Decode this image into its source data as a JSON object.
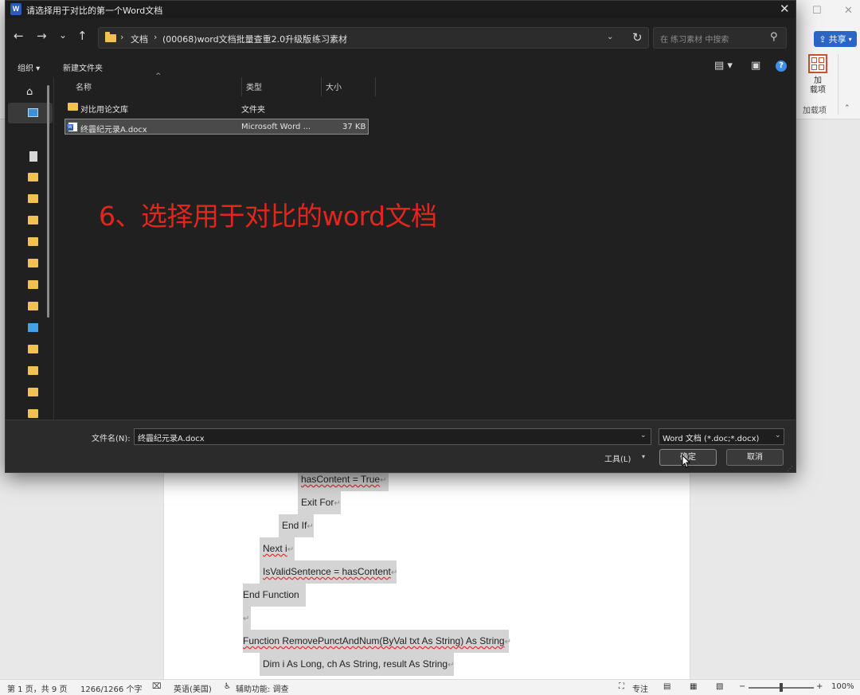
{
  "dialog": {
    "title": "请选择用于对比的第一个Word文档",
    "close_icon": "✕",
    "nav": {
      "back": "←",
      "forward": "→",
      "recent": "⌄",
      "up": "↑",
      "breadcrumbs": [
        "文档",
        "(00068)word文档批量查重2.0升级版",
        "练习素材"
      ],
      "separator": "›",
      "search_placeholder": "在 练习素材 中搜索"
    },
    "toolbar": {
      "organize": "组织",
      "new_folder": "新建文件夹"
    },
    "columns": {
      "name": "名称",
      "type": "类型",
      "size": "大小"
    },
    "files": [
      {
        "name": "对比用论文库",
        "type": "文件夹",
        "size": ""
      },
      {
        "name": "终霾纪元录A.docx",
        "type": "Microsoft Word ...",
        "size": "37 KB"
      }
    ],
    "annotation": "6、选择用于对比的word文档",
    "filename_label": "文件名(N):",
    "filename_value": "终霾纪元录A.docx",
    "filetype": "Word 文档 (*.doc;*.docx)",
    "tools": "工具(L)",
    "ok": "确定",
    "cancel": "取消"
  },
  "word": {
    "share": "共享",
    "addin_label": "加\n载项",
    "addin_group": "加载项",
    "code_lines": [
      "hasContent = True",
      "Exit For",
      "End If",
      "Next i",
      "IsValidSentence = hasContent",
      "End Function",
      "",
      "Function RemovePunctAndNum(ByVal txt As String) As String",
      "Dim i As Long, ch As String, result As String"
    ],
    "status": {
      "page": "第 1 页，共 9 页",
      "words": "1266/1266 个字",
      "lang": "英语(美国)",
      "accessibility": "辅助功能: 调查",
      "focus": "专注",
      "zoom": "100%",
      "zoom_minus": "−",
      "zoom_plus": "+"
    }
  }
}
